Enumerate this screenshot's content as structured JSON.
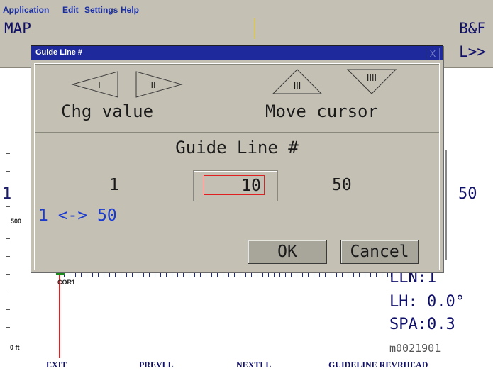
{
  "menu": [
    "Application",
    "Edit",
    "Settings",
    "Help"
  ],
  "header": {
    "title": "MAP",
    "right_top": "B&F",
    "right_bottom": "L>>"
  },
  "map": {
    "left_value": "1",
    "right_value": "50",
    "depth_mark": "500",
    "zero_label": "0 ft",
    "marker_label": "COR1",
    "status": {
      "lln": "LLN:1",
      "lh": "LH: 0.0°",
      "spa": "SPA:0.3",
      "id": "m0021901"
    }
  },
  "dialog": {
    "title": "Guide Line #",
    "close_glyph": "X",
    "left_arrow_label": "I",
    "right_arrow_label": "II",
    "up_arrow_label": "III",
    "down_arrow_label": "IIII",
    "chg_value_label": "Chg value",
    "move_cursor_label": "Move cursor",
    "heading": "Guide Line #",
    "min_value": "1",
    "current_value": "10",
    "max_value": "50",
    "range_text": "1 <-> 50",
    "ok_label": "OK",
    "cancel_label": "Cancel"
  },
  "softkeys": [
    "EXIT",
    "PREVLL",
    "NEXTLL",
    "GUIDELINE REVRHEAD"
  ]
}
